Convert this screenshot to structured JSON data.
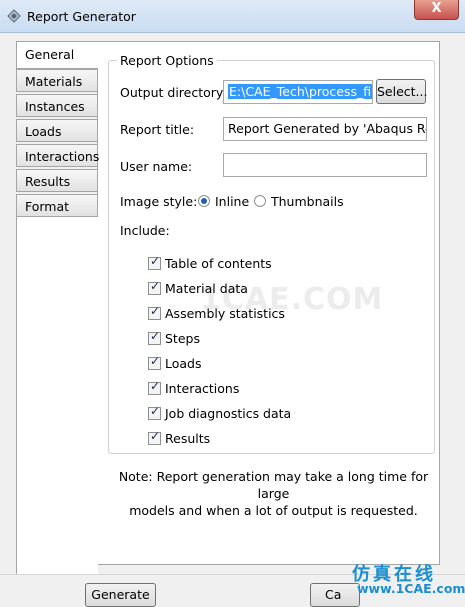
{
  "window": {
    "title": "Report Generator",
    "close_glyph": "X"
  },
  "tabs": [
    {
      "label": "General",
      "active": true
    },
    {
      "label": "Materials"
    },
    {
      "label": "Instances"
    },
    {
      "label": "Loads"
    },
    {
      "label": "Interactions"
    },
    {
      "label": "Results"
    },
    {
      "label": "Format"
    }
  ],
  "options": {
    "group_title": "Report Options",
    "output_dir_label": "Output directory:",
    "output_dir_value": "E:\\CAE_Tech\\process_file",
    "select_button": "Select...",
    "report_title_label": "Report title:",
    "report_title_value": "Report Generated by 'Abaqus Rep",
    "user_name_label": "User name:",
    "user_name_value": "",
    "image_style_label": "Image style:",
    "image_style_options": [
      "Inline",
      "Thumbnails"
    ],
    "image_style_selected": "Inline",
    "include_label": "Include:",
    "include_items": [
      {
        "label": "Table of contents",
        "checked": true
      },
      {
        "label": "Material data",
        "checked": true
      },
      {
        "label": "Assembly statistics",
        "checked": true
      },
      {
        "label": "Steps",
        "checked": true
      },
      {
        "label": "Loads",
        "checked": true
      },
      {
        "label": "Interactions",
        "checked": true
      },
      {
        "label": "Job diagnostics data",
        "checked": true
      },
      {
        "label": "Results",
        "checked": true
      }
    ],
    "note_line1": "Note: Report generation may take a long time for large",
    "note_line2": "models and when a lot of output is requested."
  },
  "buttons": {
    "generate": "Generate",
    "cancel": "Ca"
  },
  "watermark": "1CAE.COM",
  "brand": {
    "cn": "仿真在线",
    "url": "www.1CAE.com"
  },
  "colors": {
    "selection": "#3399ff",
    "close": "#c75050",
    "brand": "#1a8fd0"
  }
}
